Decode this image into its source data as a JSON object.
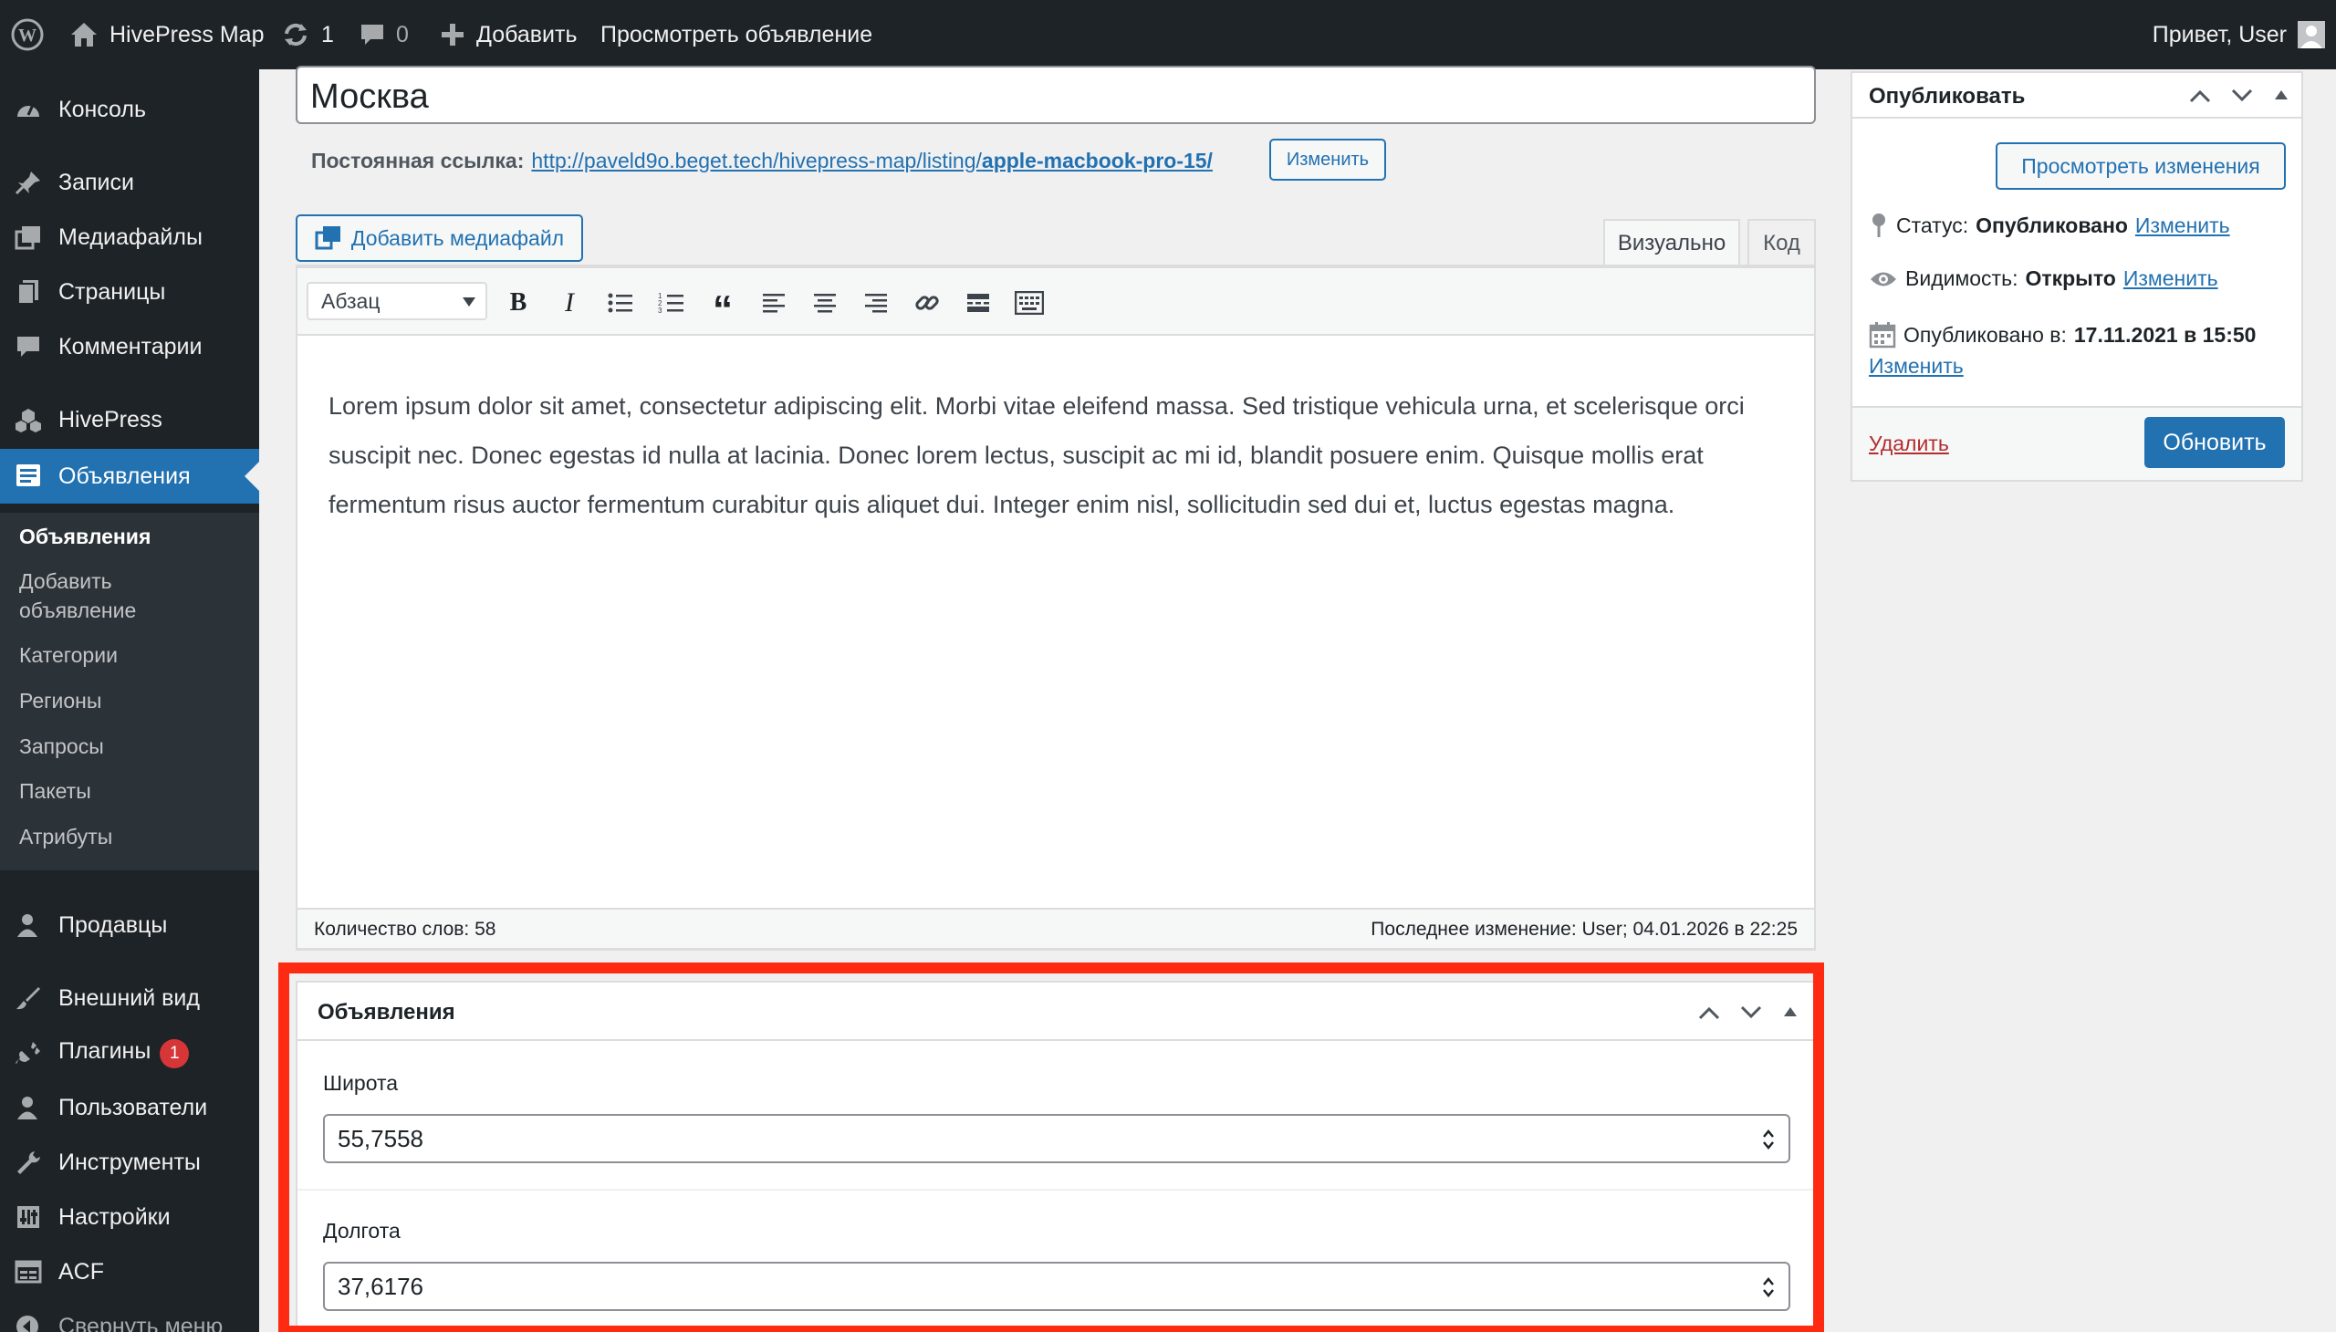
{
  "adminbar": {
    "site_name": "HivePress Map",
    "updates_count": "1",
    "comments_count": "0",
    "new_label": "Добавить",
    "view_label": "Просмотреть объявление",
    "greeting": "Привет, User"
  },
  "sidebar": {
    "items": [
      {
        "label": "Консоль",
        "icon": "dashboard-icon"
      },
      {
        "label": "Записи",
        "icon": "pin-icon"
      },
      {
        "label": "Медиафайлы",
        "icon": "media-icon"
      },
      {
        "label": "Страницы",
        "icon": "pages-icon"
      },
      {
        "label": "Комментарии",
        "icon": "comment-icon"
      },
      {
        "label": "HivePress",
        "icon": "hivepress-icon"
      },
      {
        "label": "Объявления",
        "icon": "listings-icon"
      },
      {
        "label": "Продавцы",
        "icon": "vendors-icon"
      },
      {
        "label": "Внешний вид",
        "icon": "brush-icon"
      },
      {
        "label": "Плагины",
        "icon": "plugin-icon",
        "badge": "1"
      },
      {
        "label": "Пользователи",
        "icon": "users-icon"
      },
      {
        "label": "Инструменты",
        "icon": "wrench-icon"
      },
      {
        "label": "Настройки",
        "icon": "settings-icon"
      },
      {
        "label": "ACF",
        "icon": "acf-icon"
      },
      {
        "label": "Свернуть меню",
        "icon": "collapse-icon"
      }
    ],
    "submenu": [
      "Объявления",
      "Добавить объявление",
      "Категории",
      "Регионы",
      "Запросы",
      "Пакеты",
      "Атрибуты"
    ]
  },
  "post": {
    "title": "Москва",
    "permalink_label": "Постоянная ссылка:",
    "permalink_base": "http://paveld9o.beget.tech/hivepress-map/listing/",
    "permalink_slug": "apple-macbook-pro-15/",
    "permalink_edit": "Изменить"
  },
  "editor": {
    "add_media": "Добавить медиафайл",
    "tab_visual": "Визуально",
    "tab_code": "Код",
    "format_select": "Абзац",
    "content": "Lorem ipsum dolor sit amet, consectetur adipiscing elit. Morbi vitae eleifend massa. Sed tristique vehicula urna, et scelerisque orci suscipit nec. Donec egestas id nulla at lacinia. Donec lorem lectus, suscipit ac mi id, blandit posuere enim. Quisque mollis erat fermentum risus auctor fermentum curabitur quis aliquet dui. Integer enim nisl, sollicitudin sed dui et, luctus egestas magna.",
    "word_count": "Количество слов: 58",
    "last_edit": "Последнее изменение: User; 04.01.2026 в 22:25"
  },
  "publish": {
    "title": "Опубликовать",
    "preview_button": "Просмотреть изменения",
    "status_label": "Статус:",
    "status_value": "Опубликовано",
    "visibility_label": "Видимость:",
    "visibility_value": "Открыто",
    "published_label": "Опубликовано в:",
    "published_value": "17.11.2021 в 15:50",
    "edit_link": "Изменить",
    "delete_link": "Удалить",
    "update_button": "Обновить"
  },
  "listing_box": {
    "title": "Объявления",
    "lat_label": "Широта",
    "lat_value": "55,7558",
    "lng_label": "Долгота",
    "lng_value": "37,6176"
  },
  "colors": {
    "accent": "#2271b1",
    "highlight_frame": "#ff2a12",
    "admin_bar": "#1d2327"
  }
}
